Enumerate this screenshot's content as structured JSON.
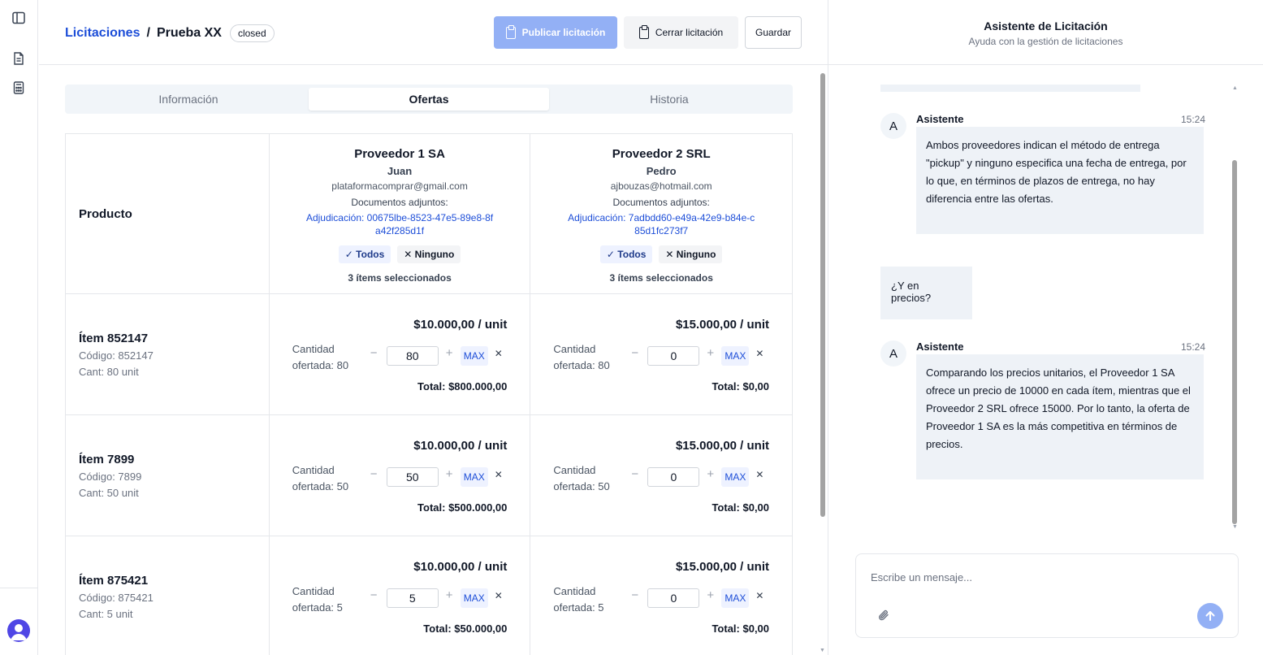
{
  "header": {
    "breadcrumb_parent": "Licitaciones",
    "separator": "/",
    "breadcrumb_current": "Prueba XX",
    "status_badge": "closed",
    "publish_label": "Publicar licitación",
    "close_label": "Cerrar licitación",
    "save_label": "Guardar"
  },
  "tabs": [
    {
      "label": "Información"
    },
    {
      "label": "Ofertas"
    },
    {
      "label": "Historia"
    }
  ],
  "table": {
    "product_header": "Producto",
    "suppliers": [
      {
        "name": "Proveedor 1 SA",
        "contact": "Juan",
        "email": "plataformacomprar@gmail.com",
        "docs_label": "Documentos adjuntos:",
        "doc_link": "Adjudicación: 00675lbe-8523-47e5-89e8-8fa42f285d1f",
        "select_all": "✓ Todos",
        "select_none": "✕ Ninguno",
        "selected_count": "3 ítems seleccionados"
      },
      {
        "name": "Proveedor 2 SRL",
        "contact": "Pedro",
        "email": "ajbouzas@hotmail.com",
        "docs_label": "Documentos adjuntos:",
        "doc_link": "Adjudicación: 7adbdd60-e49a-42e9-b84e-c85d1fc273f7",
        "select_all": "✓ Todos",
        "select_none": "✕ Ninguno",
        "selected_count": "3 ítems seleccionados"
      }
    ],
    "items": [
      {
        "name": "Ítem 852147",
        "code": "Código: 852147",
        "qty": "Cant: 80 unit",
        "offers": [
          {
            "price": "$10.000,00 / unit",
            "qty_label": "Cantidad ofertada: 80",
            "value": "80",
            "total": "Total: $800.000,00"
          },
          {
            "price": "$15.000,00 / unit",
            "qty_label": "Cantidad ofertada: 80",
            "value": "0",
            "total": "Total: $0,00"
          }
        ]
      },
      {
        "name": "Ítem 7899",
        "code": "Código: 7899",
        "qty": "Cant: 50 unit",
        "offers": [
          {
            "price": "$10.000,00 / unit",
            "qty_label": "Cantidad ofertada: 50",
            "value": "50",
            "total": "Total: $500.000,00"
          },
          {
            "price": "$15.000,00 / unit",
            "qty_label": "Cantidad ofertada: 50",
            "value": "0",
            "total": "Total: $0,00"
          }
        ]
      },
      {
        "name": "Ítem 875421",
        "code": "Código: 875421",
        "qty": "Cant: 5 unit",
        "offers": [
          {
            "price": "$10.000,00 / unit",
            "qty_label": "Cantidad ofertada: 5",
            "value": "5",
            "total": "Total: $50.000,00"
          },
          {
            "price": "$15.000,00 / unit",
            "qty_label": "Cantidad ofertada: 5",
            "value": "0",
            "total": "Total: $0,00"
          }
        ]
      }
    ],
    "stepper": {
      "minus": "−",
      "plus": "+",
      "max": "MAX",
      "clear": "✕"
    }
  },
  "assistant": {
    "title": "Asistente de Licitación",
    "subtitle": "Ayuda con la gestión de licitaciones",
    "avatar_letter": "A",
    "messages": [
      {
        "sender": "Asistente",
        "time": "15:24",
        "text": "Ambos proveedores indican el método de entrega \"pickup\" y ninguno especifica una fecha de entrega, por lo que, en términos de plazos de entrega, no hay diferencia entre las ofertas."
      },
      {
        "sender": "user",
        "text": "¿Y en precios?"
      },
      {
        "sender": "Asistente",
        "time": "15:24",
        "text": "Comparando los precios unitarios, el Proveedor 1 SA ofrece un precio de 10000 en cada ítem, mientras que el Proveedor 2 SRL ofrece 15000. Por lo tanto, la oferta de Proveedor 1 SA es la más competitiva en términos de precios."
      }
    ],
    "composer_placeholder": "Escribe un mensaje..."
  },
  "icons": {
    "sidebar_toggle": "sidebar-toggle-icon",
    "document": "document-icon",
    "calculator": "calculator-icon",
    "clipboard": "clipboard-icon",
    "attach": "paperclip-icon",
    "send": "arrow-up-icon"
  },
  "colors": {
    "accent": "#1d4ed8",
    "publish_disabled": "#93b0f5",
    "bubble": "#eef2f7"
  }
}
